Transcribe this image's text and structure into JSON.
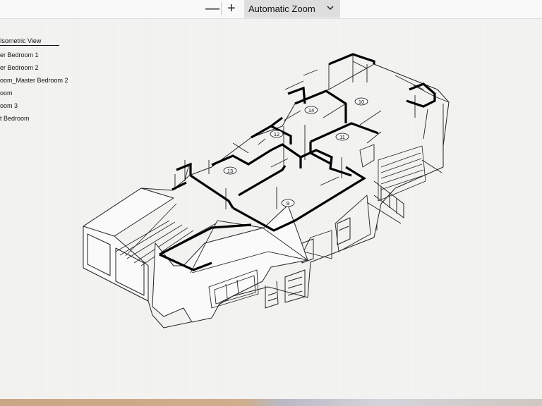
{
  "toolbar": {
    "zoom_out_label": "—",
    "zoom_in_label": "+",
    "zoom_value": "Automatic Zoom",
    "dropdown_icon": "chevron-down-icon"
  },
  "legend": {
    "title": "Isometric View",
    "items": [
      "er Bedroom 1",
      "er Bedroom 2",
      "oom_Master Bedroom 2",
      "oom",
      "oom 3",
      "t Bedroom"
    ]
  },
  "room_labels": [
    "9",
    "10",
    "11",
    "12",
    "13",
    "14"
  ]
}
